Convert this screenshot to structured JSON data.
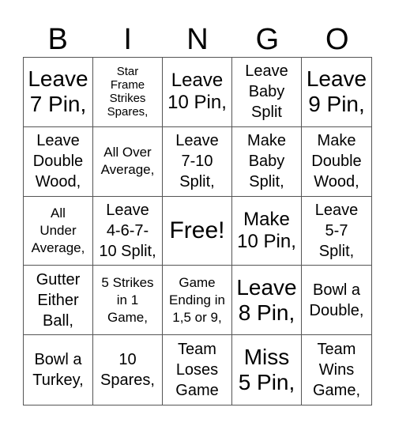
{
  "header": {
    "letters": [
      "B",
      "I",
      "N",
      "G",
      "O"
    ]
  },
  "cells": [
    "Leave\n7 Pin,",
    "Star\nFrame\nStrikes\nSpares,",
    "Leave\n10 Pin,",
    "Leave\nBaby\nSplit",
    "Leave\n9 Pin,",
    "Leave\nDouble\nWood,",
    "All Over\nAverage,",
    "Leave\n7-10\nSplit,",
    "Make\nBaby\nSplit,",
    "Make\nDouble\nWood,",
    "All\nUnder\nAverage,",
    "Leave\n4-6-7-\n10 Split,",
    "Free!",
    "Make\n10 Pin,",
    "Leave\n5-7\nSplit,",
    "Gutter\nEither\nBall,",
    "5 Strikes\nin 1\nGame,",
    "Game\nEnding in\n1,5 or 9,",
    "Leave\n8 Pin,",
    "Bowl a\nDouble,",
    "Bowl a\nTurkey,",
    "10\nSpares,",
    "Team\nLoses\nGame",
    "Miss\n5 Pin,",
    "Team\nWins\nGame,"
  ]
}
